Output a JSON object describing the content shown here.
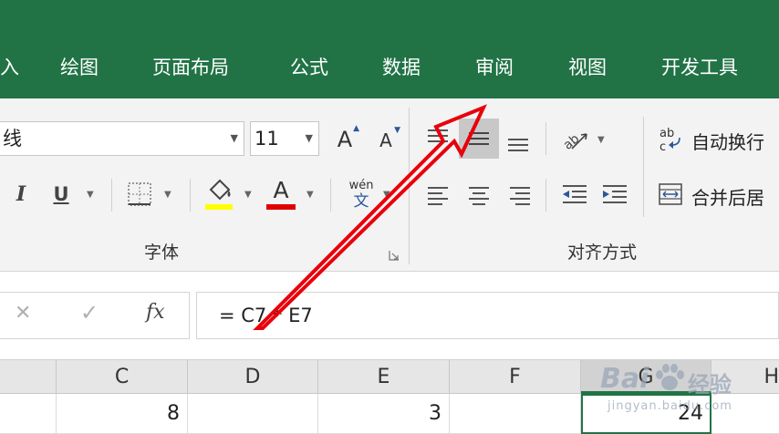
{
  "ribbon_tabs": [
    "入",
    "绘图",
    "页面布局",
    "公式",
    "数据",
    "审阅",
    "视图",
    "开发工具"
  ],
  "font_group": {
    "font_name": "线",
    "font_size": "11",
    "italic_label": "I",
    "underline_label": "U",
    "font_color_label": "A",
    "grow_font_label": "A",
    "shrink_font_label": "A",
    "phonetic_top": "wén",
    "phonetic_bottom": "文",
    "highlight_color": "#ffff00",
    "font_color": "#ff0000",
    "group_label": "字体"
  },
  "align_group": {
    "wrap_text_label": "自动换行",
    "merge_label": "合并后居",
    "group_label": "对齐方式"
  },
  "formula_bar": {
    "cancel_symbol": "✕",
    "confirm_symbol": "✓",
    "fx_label": "fx",
    "formula": "= C7 * E7"
  },
  "grid": {
    "columns": [
      "C",
      "D",
      "E",
      "F",
      "G",
      "H"
    ],
    "row_values": [
      "8",
      "",
      "3",
      "",
      "24",
      ""
    ]
  },
  "watermark": {
    "brand": "Bai",
    "brand_suffix": "经验",
    "url": "jingyan.baidu.com"
  },
  "colors": {
    "tab_bar": "#217346",
    "annotation_arrow": "#e8000b"
  }
}
